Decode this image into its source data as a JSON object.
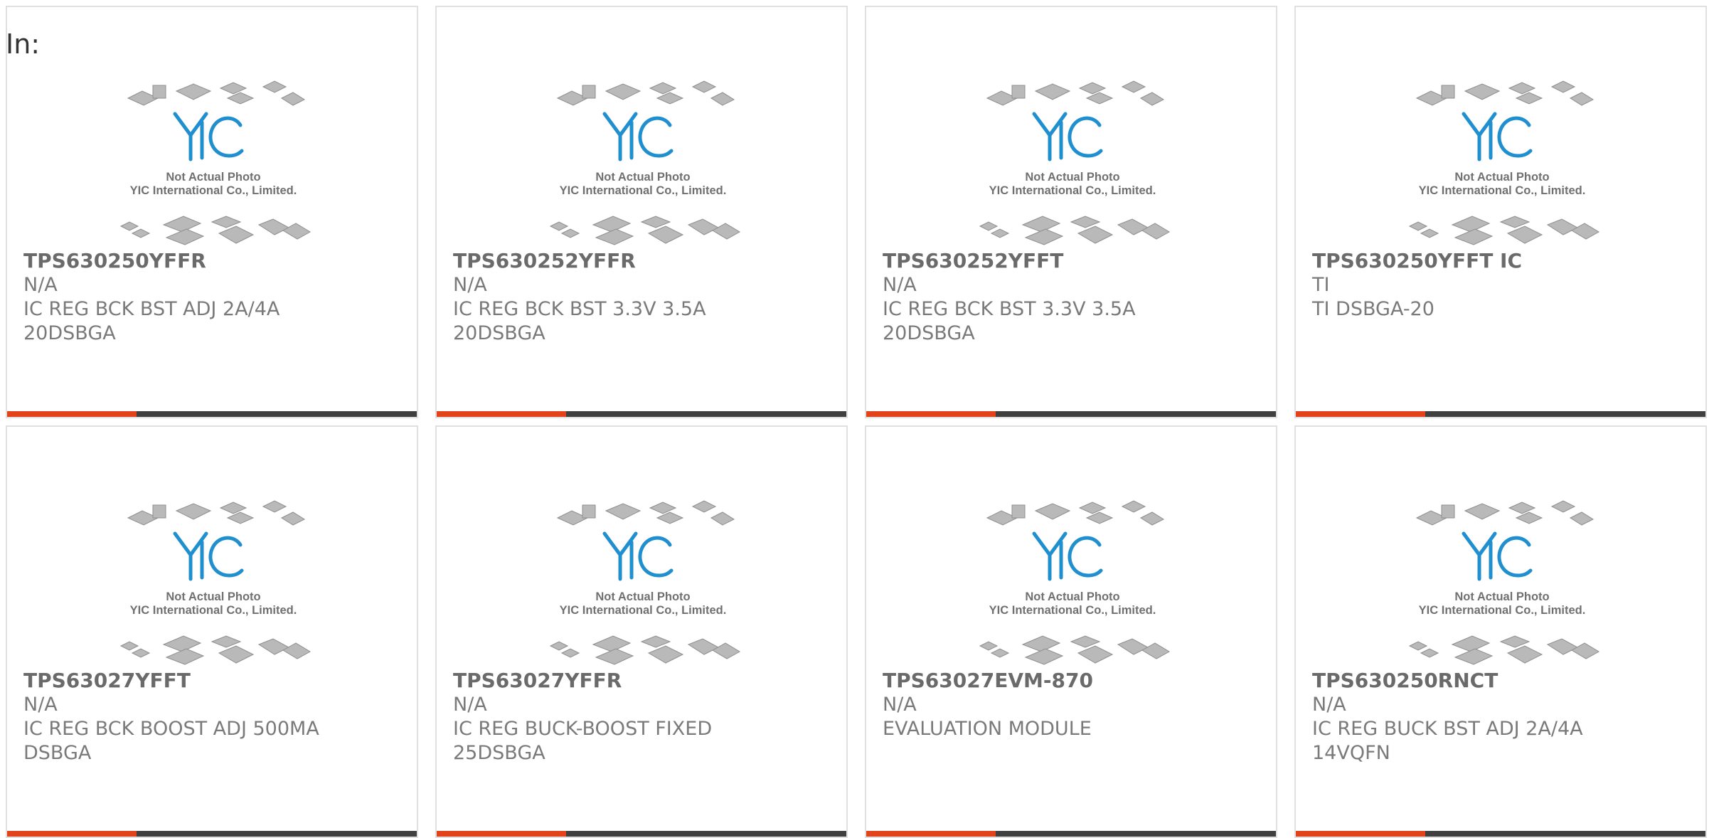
{
  "heading": "In:",
  "photo": {
    "brand_logo": "YIC",
    "caption_line1": "Not Actual Photo",
    "caption_line2": "YIC International Co., Limited."
  },
  "colors": {
    "accent": "#e2431a",
    "bar": "#404040",
    "logo_blue": "#1f8fd0",
    "text": "#6a6a6a"
  },
  "products": [
    {
      "part_number": "TPS630250YFFR",
      "manufacturer": "N/A",
      "description": "IC REG BCK BST ADJ 2A/4A",
      "package": "20DSBGA"
    },
    {
      "part_number": "TPS630252YFFR",
      "manufacturer": "N/A",
      "description": "IC REG BCK BST 3.3V 3.5A",
      "package": "20DSBGA"
    },
    {
      "part_number": "TPS630252YFFT",
      "manufacturer": "N/A",
      "description": "IC REG BCK BST 3.3V 3.5A",
      "package": "20DSBGA"
    },
    {
      "part_number": "TPS630250YFFT IC",
      "manufacturer": "TI",
      "description": "TI DSBGA-20",
      "package": ""
    },
    {
      "part_number": "TPS63027YFFT",
      "manufacturer": "N/A",
      "description": "IC REG BCK BOOST ADJ 500MA",
      "package": "DSBGA"
    },
    {
      "part_number": "TPS63027YFFR",
      "manufacturer": "N/A",
      "description": "IC REG BUCK-BOOST FIXED",
      "package": "25DSBGA"
    },
    {
      "part_number": "TPS63027EVM-870",
      "manufacturer": "N/A",
      "description": "EVALUATION MODULE",
      "package": ""
    },
    {
      "part_number": "TPS630250RNCT",
      "manufacturer": "N/A",
      "description": "IC REG BUCK BST ADJ 2A/4A",
      "package": "14VQFN"
    }
  ]
}
